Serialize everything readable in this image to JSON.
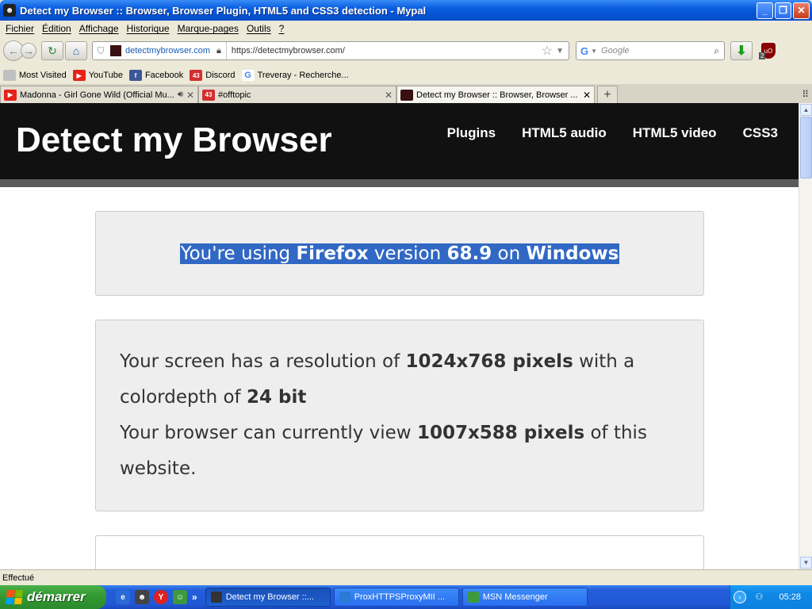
{
  "window": {
    "title": "Detect my Browser :: Browser, Browser Plugin, HTML5 and CSS3 detection - Mypal",
    "buttons": {
      "minimize": "_",
      "maximize": "❐",
      "close": "✕"
    }
  },
  "menubar": {
    "items": [
      "Fichier",
      "Édition",
      "Affichage",
      "Historique",
      "Marque-pages",
      "Outils",
      "?"
    ]
  },
  "navbar": {
    "domain": "detectmybrowser.com",
    "url": "https://detectmybrowser.com/",
    "search_placeholder": "Google",
    "ublock_count": "2"
  },
  "bookmarks": [
    {
      "label": "Most Visited",
      "icon": "#c0c0c0"
    },
    {
      "label": "YouTube",
      "icon": "#e62117"
    },
    {
      "label": "Facebook",
      "icon": "#3b5998"
    },
    {
      "label": "Discord",
      "icon": "#d32f2f"
    },
    {
      "label": "Treveray - Recherche...",
      "icon": "#4285f4"
    }
  ],
  "tabs": [
    {
      "label": "Madonna - Girl Gone Wild (Official Mu...",
      "active": false
    },
    {
      "label": "#offtopic",
      "active": false
    },
    {
      "label": "Detect my Browser :: Browser, Browser ...",
      "active": true
    }
  ],
  "site": {
    "brand": "Detect my Browser",
    "nav": [
      "Plugins",
      "HTML5 audio",
      "HTML5 video",
      "CSS3"
    ],
    "detect": {
      "prefix": "You're using ",
      "browser": "Firefox",
      "mid1": " version ",
      "version": "68.9",
      "mid2": " on ",
      "os": "Windows"
    },
    "screen": {
      "t1": "Your screen has a resolution of ",
      "resolution": "1024x768 pixels",
      "t2": " with a colordepth of ",
      "depth": "24 bit",
      "t3": "Your browser can currently view ",
      "viewport": "1007x588 pixels",
      "t4": " of this website."
    }
  },
  "statusbar": {
    "text": "Effectué"
  },
  "taskbar": {
    "start": "démarrer",
    "tasks": [
      {
        "label": "Detect my Browser ::...",
        "active": true,
        "icon": "#333"
      },
      {
        "label": "ProxHTTPSProxyMII ...",
        "active": false,
        "icon": "#2a7ad8"
      },
      {
        "label": "MSN Messenger",
        "active": false,
        "icon": "#3c9a3c"
      }
    ],
    "clock": "05:28"
  },
  "colors": {
    "selection": "#3168c4",
    "header_bg": "#111111",
    "xp_blue": "#0553d4",
    "start_green": "#319831"
  }
}
